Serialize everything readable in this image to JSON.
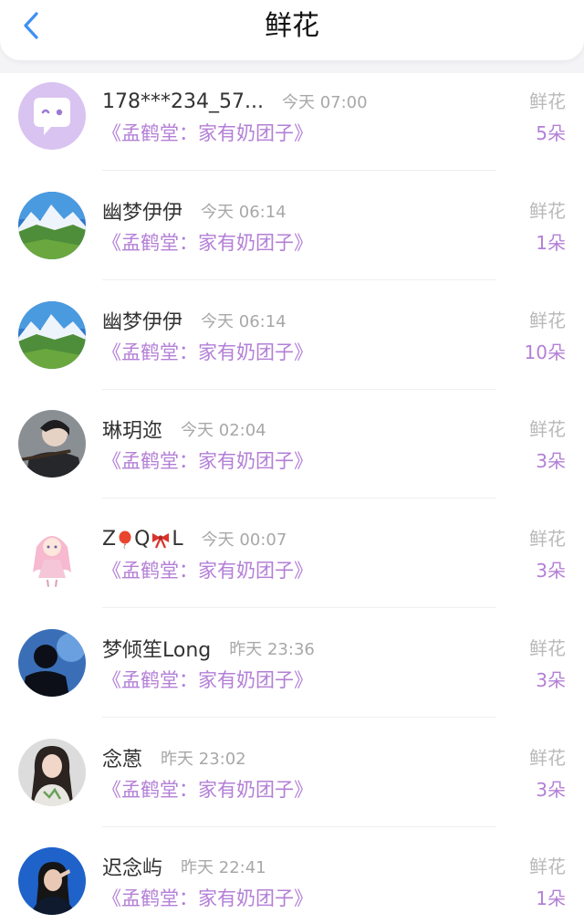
{
  "header": {
    "title": "鲜花",
    "back_icon": "chevron-left-icon",
    "accent": "#3d8ff5"
  },
  "colors": {
    "book": "#b37fd6",
    "muted": "#b9b9b9"
  },
  "items": [
    {
      "name": "178***234_57...",
      "time": "今天 07:00",
      "book": "《孟鹤堂：家有奶团子》",
      "gift": "鲜花",
      "count": "5朵",
      "avatar": "chat-bubble-avatar"
    },
    {
      "name": "幽梦伊伊",
      "time": "今天 06:14",
      "book": "《孟鹤堂：家有奶团子》",
      "gift": "鲜花",
      "count": "1朵",
      "avatar": "mountain-landscape-avatar"
    },
    {
      "name": "幽梦伊伊",
      "time": "今天 06:14",
      "book": "《孟鹤堂：家有奶团子》",
      "gift": "鲜花",
      "count": "10朵",
      "avatar": "mountain-landscape-avatar"
    },
    {
      "name": "琳玥迩",
      "time": "今天 02:04",
      "book": "《孟鹤堂：家有奶团子》",
      "gift": "鲜花",
      "count": "3朵",
      "avatar": "flute-player-avatar"
    },
    {
      "name_parts": [
        "Z",
        "Q",
        "L"
      ],
      "name_icons": [
        "balloon-emoji-icon",
        "ribbon-emoji-icon"
      ],
      "time": "今天 00:07",
      "book": "《孟鹤堂：家有奶团子》",
      "gift": "鲜花",
      "count": "3朵",
      "avatar": "anime-girl-avatar"
    },
    {
      "name": "梦倾笙Long",
      "time": "昨天 23:36",
      "book": "《孟鹤堂：家有奶团子》",
      "gift": "鲜花",
      "count": "3朵",
      "avatar": "silhouette-avatar"
    },
    {
      "name": "念蒽",
      "time": "昨天 23:02",
      "book": "《孟鹤堂：家有奶团子》",
      "gift": "鲜花",
      "count": "3朵",
      "avatar": "girl-portrait-avatar"
    },
    {
      "name": "迟念屿",
      "time": "昨天 22:41",
      "book": "《孟鹤堂：家有奶团子》",
      "gift": "鲜花",
      "count": "1朵",
      "avatar": "blue-portrait-avatar"
    }
  ]
}
